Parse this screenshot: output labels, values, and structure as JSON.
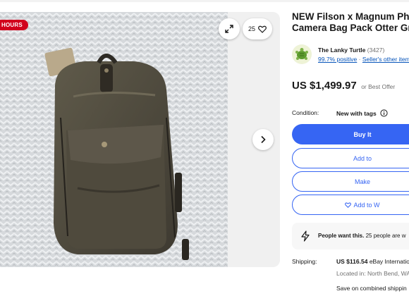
{
  "badge": {
    "text": "HOURS"
  },
  "gallery": {
    "watch_count": "25"
  },
  "listing": {
    "title_line1": "NEW Filson x Magnum Photo",
    "title_line2": "Camera Bag Pack Otter Gre"
  },
  "seller": {
    "name": "The Lanky Turtle",
    "feedback_count": "(3427)",
    "positive": "99.7% positive",
    "separator": "·",
    "other_items": "Seller's other items"
  },
  "price": {
    "amount": "US $1,499.97",
    "best_offer": "or Best Offer"
  },
  "condition": {
    "label": "Condition:",
    "value": "New with tags"
  },
  "buttons": {
    "buy": "Buy It",
    "cart": "Add to",
    "offer": "Make",
    "watch": "Add to W"
  },
  "promo": {
    "bold": "People want this.",
    "text": "25 people are w"
  },
  "shipping": {
    "label": "Shipping:",
    "price": "US $116.54",
    "service": "eBay Internation",
    "location": "Located in: North Bend, WA",
    "combined": "Save on combined shippin"
  },
  "colors": {
    "primary": "#3665f3",
    "badge": "#d1001c",
    "link": "#0654ba",
    "muted": "#707070"
  }
}
